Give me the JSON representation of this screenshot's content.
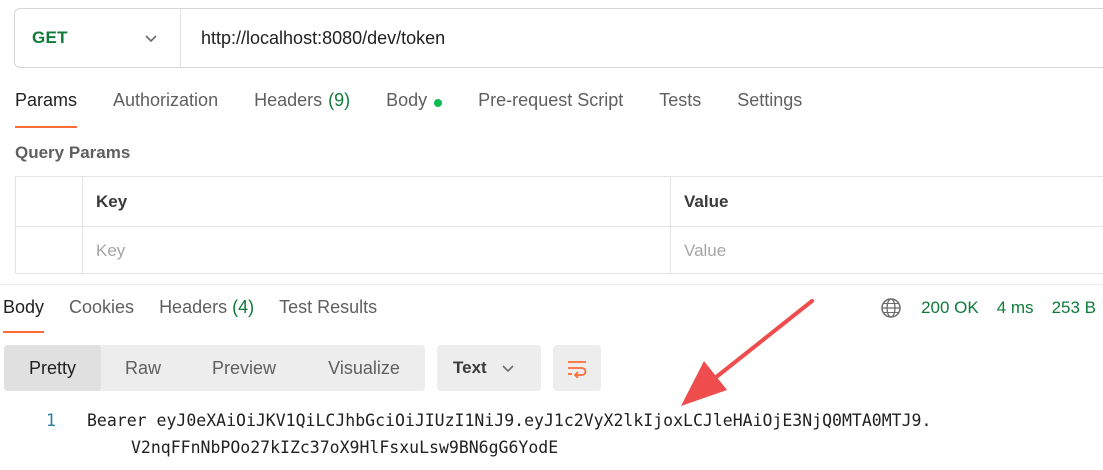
{
  "request": {
    "method": "GET",
    "url": "http://localhost:8080/dev/token"
  },
  "request_tabs": [
    {
      "label": "Params",
      "active": true
    },
    {
      "label": "Authorization"
    },
    {
      "label": "Headers",
      "count": "(9)"
    },
    {
      "label": "Body",
      "dot": true
    },
    {
      "label": "Pre-request Script"
    },
    {
      "label": "Tests"
    },
    {
      "label": "Settings"
    }
  ],
  "query_params": {
    "title": "Query Params",
    "header_key": "Key",
    "header_value": "Value",
    "placeholder_key": "Key",
    "placeholder_value": "Value"
  },
  "response_tabs": [
    {
      "label": "Body",
      "active": true
    },
    {
      "label": "Cookies"
    },
    {
      "label": "Headers",
      "count": "(4)"
    },
    {
      "label": "Test Results"
    }
  ],
  "response_meta": {
    "status": "200 OK",
    "time": "4 ms",
    "size": "253 B"
  },
  "view_modes": [
    "Pretty",
    "Raw",
    "Preview",
    "Visualize"
  ],
  "active_view": "Pretty",
  "format": "Text",
  "body": {
    "line_number": "1",
    "line_1": "Bearer eyJ0eXAiOiJKV1QiLCJhbGciOiJIUzI1NiJ9.eyJ1c2VyX2lkIjoxLCJleHAiOjE3NjQ0MTA0MTJ9.",
    "line_1_wrap": "V2nqFFnNbPOo27kIZc37oX9HlFsxuLsw9BN6gG6YodE"
  },
  "colors": {
    "accent": "#ff6c37",
    "success": "#0f7b3a",
    "annotation_arrow": "#ef4d4d"
  }
}
